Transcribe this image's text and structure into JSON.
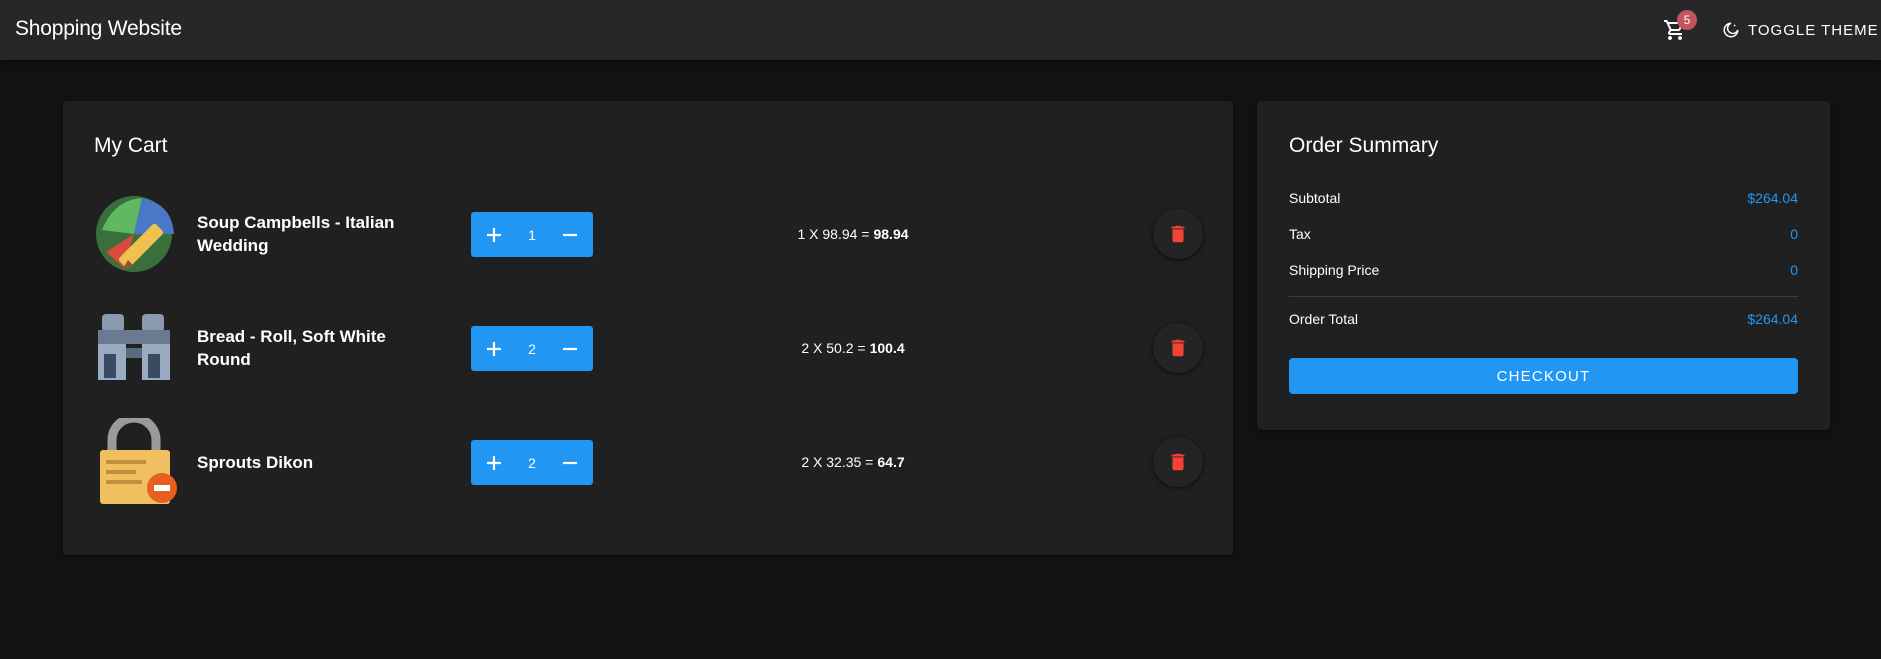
{
  "appbar": {
    "title": "Shopping Website",
    "cart_count": "5",
    "toggle_theme_label": "TOGGLE THEME"
  },
  "cart": {
    "title": "My Cart",
    "items": [
      {
        "name": "Soup Campbells - Italian Wedding",
        "quantity": "1",
        "calc": "1 X 98.94 =",
        "total": "98.94",
        "thumbnail": "image-editor-icon"
      },
      {
        "name": "Bread - Roll, Soft White Round",
        "quantity": "2",
        "calc": "2 X 50.2 =",
        "total": "100.4",
        "thumbnail": "binoculars-icon"
      },
      {
        "name": "Sprouts Dikon",
        "quantity": "2",
        "calc": "2 X 32.35 =",
        "total": "64.7",
        "thumbnail": "lock-certificate-icon"
      }
    ]
  },
  "summary": {
    "title": "Order Summary",
    "subtotal_label": "Subtotal",
    "subtotal_value": "$264.04",
    "tax_label": "Tax",
    "tax_value": "0",
    "shipping_label": "Shipping Price",
    "shipping_value": "0",
    "total_label": "Order Total",
    "total_value": "$264.04",
    "checkout_label": "CHECKOUT"
  },
  "colors": {
    "accent": "#2196f3",
    "delete": "#f44336",
    "badge": "#c05560",
    "background": "#121212",
    "surface": "#202020"
  }
}
